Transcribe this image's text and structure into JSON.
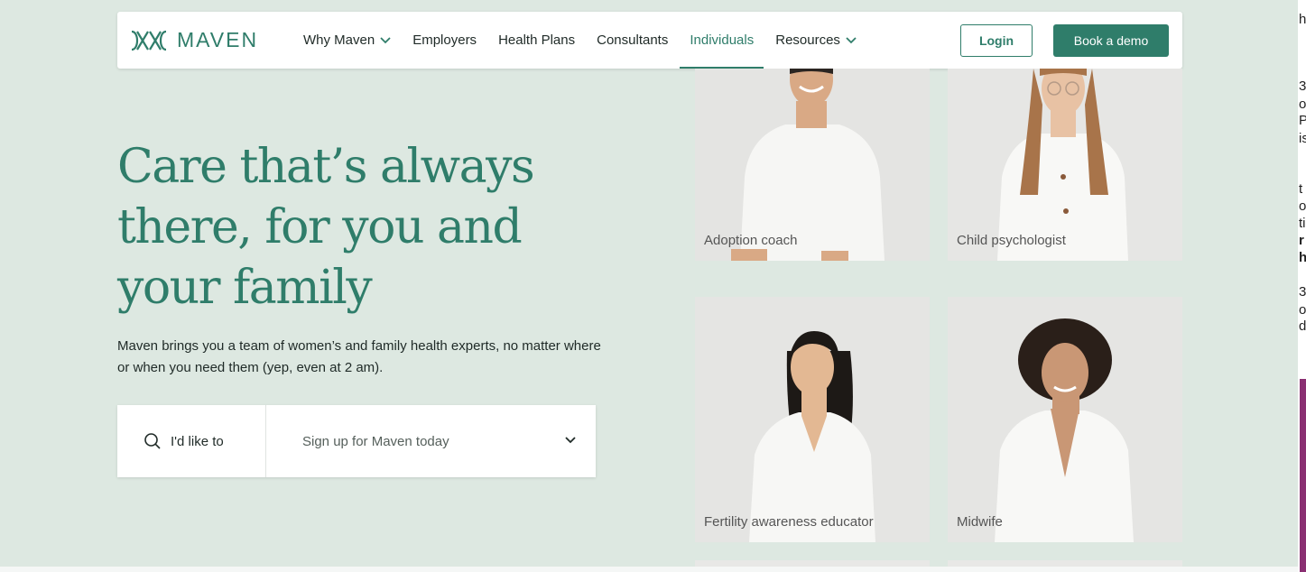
{
  "brand": {
    "name": "MAVEN",
    "accent": "#2f7d6a",
    "background": "#dde8e1"
  },
  "nav": {
    "items": [
      {
        "label": "Why Maven",
        "dropdown": true,
        "active": false
      },
      {
        "label": "Employers",
        "dropdown": false,
        "active": false
      },
      {
        "label": "Health Plans",
        "dropdown": false,
        "active": false
      },
      {
        "label": "Consultants",
        "dropdown": false,
        "active": false
      },
      {
        "label": "Individuals",
        "dropdown": false,
        "active": true
      },
      {
        "label": "Resources",
        "dropdown": true,
        "active": false
      }
    ],
    "login_label": "Login",
    "demo_label": "Book a demo"
  },
  "hero": {
    "headline": "Care that’s always there, for you and your family",
    "subtext": "Maven brings you a team of women’s and family health experts, no matter where or when you need them (yep, even at 2 am).",
    "selector": {
      "prefix_label": "I'd like to",
      "selected_value": "Sign up for Maven today"
    }
  },
  "providers": [
    {
      "role": "Adoption coach"
    },
    {
      "role": "Child psychologist"
    },
    {
      "role": "Fertility awareness educator"
    },
    {
      "role": "Midwife"
    }
  ],
  "side_fragments": [
    "h",
    "3",
    "ol",
    "P",
    "is",
    "t",
    "ob",
    "ti",
    "r",
    "h",
    "3",
    "o",
    "d"
  ]
}
